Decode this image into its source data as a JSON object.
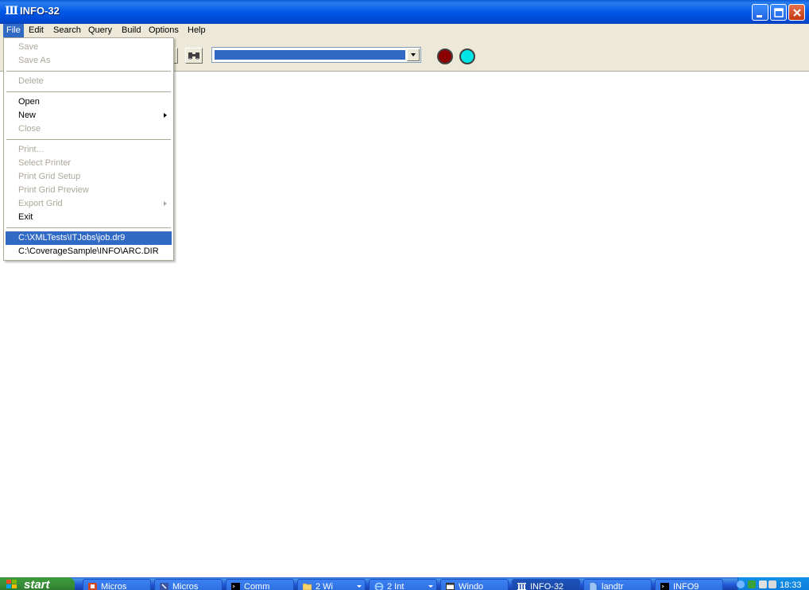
{
  "window": {
    "title": "INFO-32",
    "icon": "columns-icon",
    "controls": {
      "minimize": "minimize-icon",
      "maximize": "maximize-icon",
      "close": "close-icon"
    }
  },
  "menubar": {
    "items": [
      {
        "label": "File",
        "active": true
      },
      {
        "label": "Edit"
      },
      {
        "label": "Search"
      },
      {
        "label": "Query"
      },
      {
        "label": "Build"
      },
      {
        "label": "Options"
      },
      {
        "label": "Help"
      }
    ]
  },
  "toolbar": {
    "find_icon": "binoculars-icon",
    "combo_value": "",
    "stop_color": "#8b0000",
    "go_color": "#00e5e5"
  },
  "file_menu": {
    "save": "Save",
    "save_as": "Save As",
    "delete": "Delete",
    "open": "Open",
    "new": "New",
    "close": "Close",
    "print": "Print...",
    "select_printer": "Select Printer",
    "print_grid_setup": "Print Grid Setup",
    "print_grid_preview": "Print Grid Preview",
    "export_grid": "Export Grid",
    "exit": "Exit",
    "recent_1": "C:\\XMLTests\\ITJobs\\job.dr9",
    "recent_2": "C:\\CoverageSample\\INFO\\ARC.DIR"
  },
  "taskbar": {
    "start": "start",
    "buttons": [
      {
        "label": "Micros",
        "icon": "powerpoint-icon"
      },
      {
        "label": "Micros",
        "icon": "visio-icon"
      },
      {
        "label": "Comm",
        "icon": "console-icon"
      },
      {
        "label": "2 Wi",
        "icon": "folder-icon"
      },
      {
        "label": "2 Int",
        "icon": "ie-icon"
      },
      {
        "label": "Windo",
        "icon": "window-icon"
      },
      {
        "label": "INFO-32",
        "icon": "columns-icon"
      },
      {
        "label": "landtr",
        "icon": "document-icon"
      },
      {
        "label": "INFO9",
        "icon": "console-icon"
      }
    ],
    "clock": "18:33"
  }
}
